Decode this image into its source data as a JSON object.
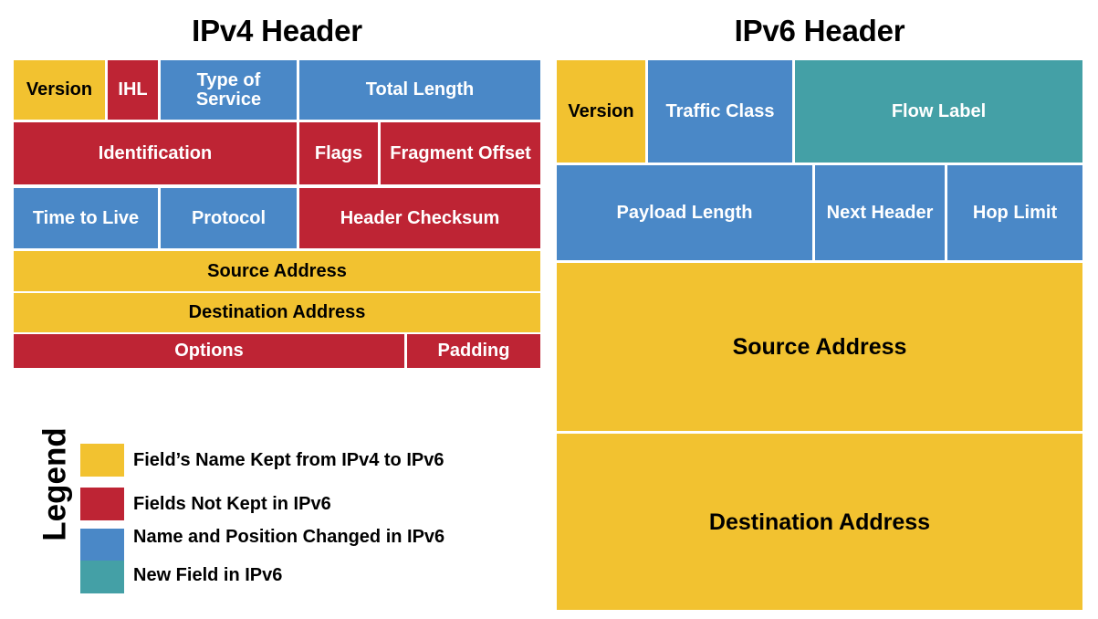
{
  "panels": {
    "ipv4": {
      "title": "IPv4 Header",
      "fields": [
        {
          "label": "Version",
          "color": "yellow"
        },
        {
          "label": "IHL",
          "color": "red"
        },
        {
          "label": "Type of Service",
          "color": "blue"
        },
        {
          "label": "Total Length",
          "color": "blue"
        },
        {
          "label": "Identification",
          "color": "red"
        },
        {
          "label": "Flags",
          "color": "red"
        },
        {
          "label": "Fragment Offset",
          "color": "red"
        },
        {
          "label": "Time to Live",
          "color": "blue"
        },
        {
          "label": "Protocol",
          "color": "blue"
        },
        {
          "label": "Header Checksum",
          "color": "red"
        },
        {
          "label": "Source Address",
          "color": "yellow"
        },
        {
          "label": "Destination Address",
          "color": "yellow"
        },
        {
          "label": "Options",
          "color": "red"
        },
        {
          "label": "Padding",
          "color": "red"
        }
      ]
    },
    "ipv6": {
      "title": "IPv6 Header",
      "fields": [
        {
          "label": "Version",
          "color": "yellow"
        },
        {
          "label": "Traffic Class",
          "color": "blue"
        },
        {
          "label": "Flow Label",
          "color": "teal"
        },
        {
          "label": "Payload Length",
          "color": "blue"
        },
        {
          "label": "Next Header",
          "color": "blue"
        },
        {
          "label": "Hop Limit",
          "color": "blue"
        },
        {
          "label": "Source Address",
          "color": "yellow"
        },
        {
          "label": "Destination Address",
          "color": "yellow"
        }
      ]
    }
  },
  "legend": {
    "title": "Legend",
    "items": [
      {
        "color": "yellow",
        "swatch_hex": "#f2c230",
        "label": "Field’s Name Kept from IPv4 to IPv6"
      },
      {
        "color": "red",
        "swatch_hex": "#be2434",
        "label": "Fields Not Kept in IPv6"
      },
      {
        "color": "blue",
        "swatch_hex": "#4a88c7",
        "label": "Name and Position Changed in IPv6"
      },
      {
        "color": "teal",
        "swatch_hex": "#44a0a6",
        "label": "New Field in IPv6"
      }
    ]
  },
  "colors": {
    "yellow": "#f2c230",
    "red": "#be2434",
    "blue": "#4a88c7",
    "teal": "#44a0a6",
    "background": "#ffffff",
    "text_dark": "#000000",
    "text_light": "#ffffff"
  }
}
